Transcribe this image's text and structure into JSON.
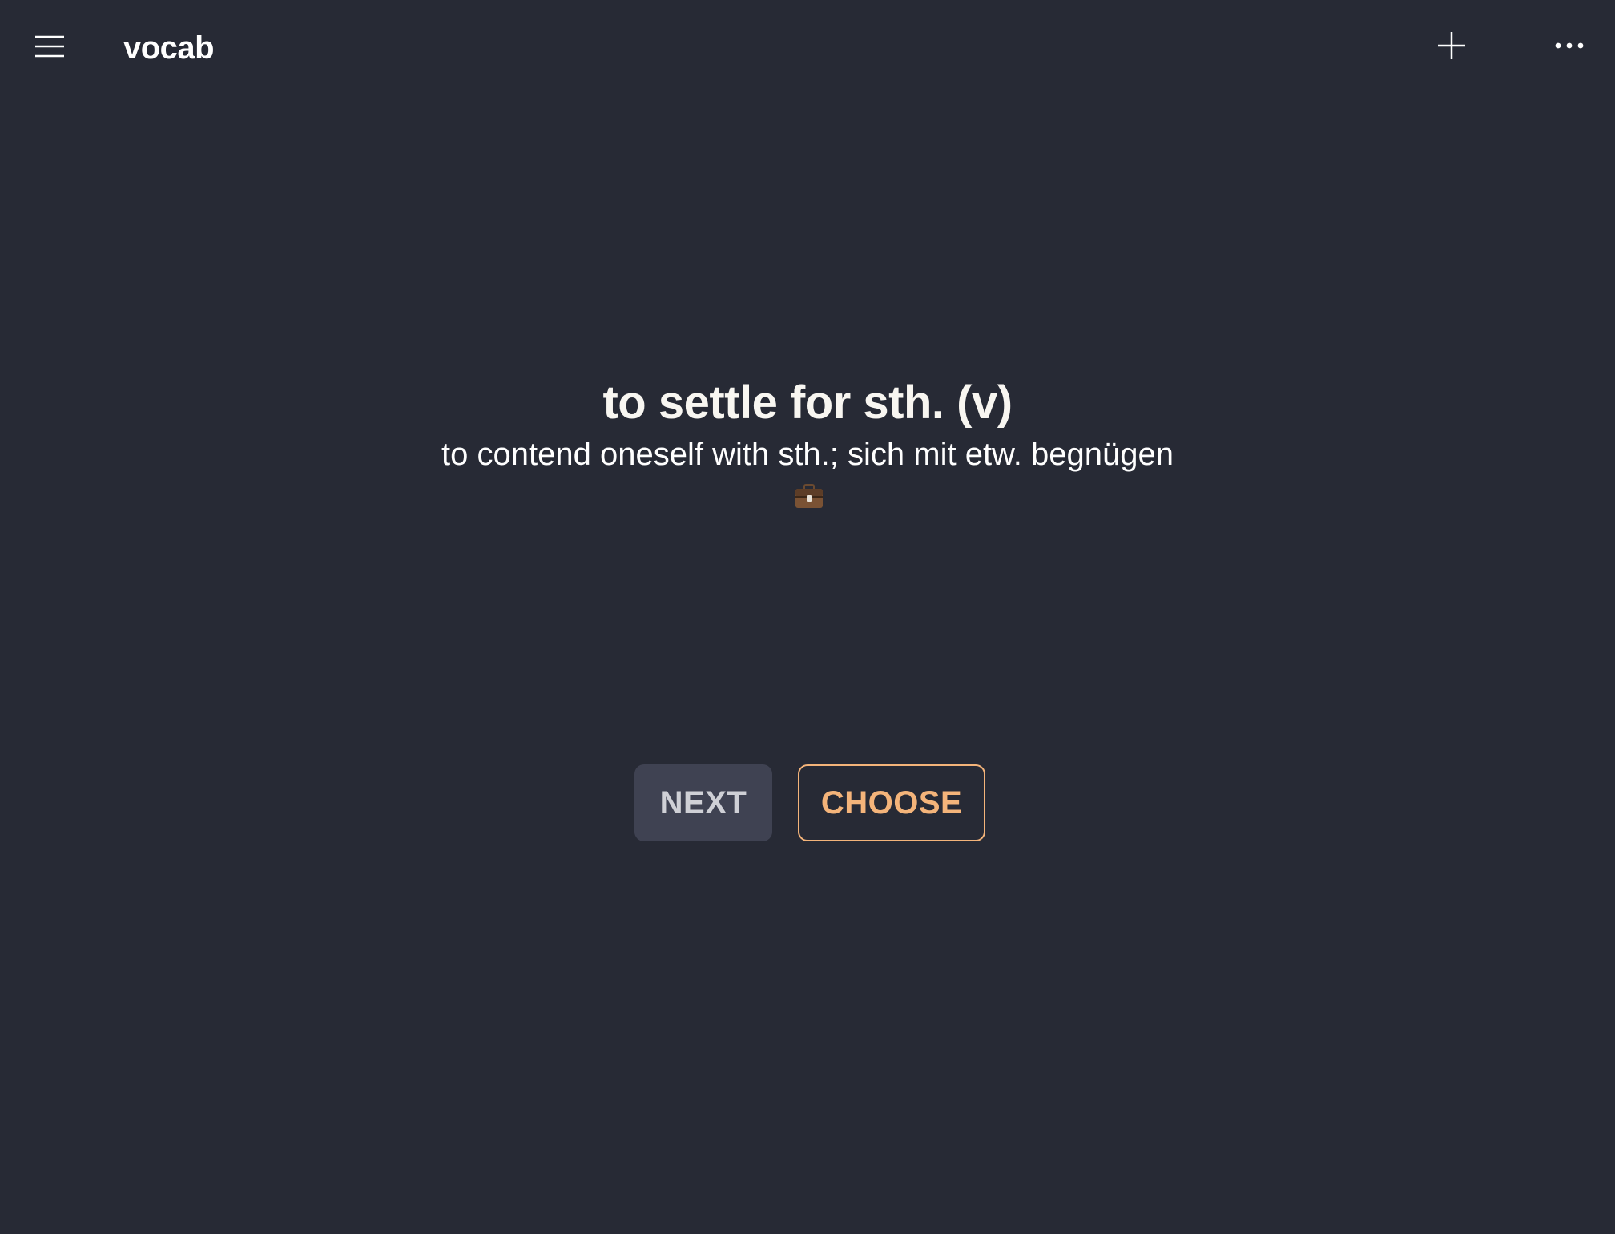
{
  "app_bar": {
    "title": "vocab",
    "menu_icon": "hamburger-menu-icon",
    "add_icon": "plus-icon",
    "more_icon": "more-horizontal-icon"
  },
  "card": {
    "term": "to settle for sth. (v)",
    "definition": "to contend oneself with sth.; sich mit etw. begnügen",
    "category_icon": "briefcase-icon"
  },
  "actions": {
    "next_label": "NEXT",
    "choose_label": "CHOOSE"
  },
  "colors": {
    "background": "#272a35",
    "accent": "#f4b47a",
    "next_button_bg": "#3f4252"
  }
}
